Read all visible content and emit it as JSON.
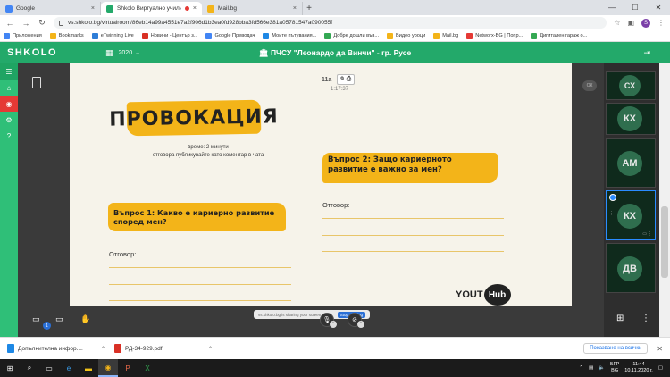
{
  "browser": {
    "tabs": [
      {
        "label": "Google",
        "favicon_color": "#4285f4",
        "close": "×"
      },
      {
        "label": "Shkolo Виртуално училище",
        "favicon_color": "#23a96a",
        "close": "×",
        "recording": true
      },
      {
        "label": "Mail.bg",
        "favicon_color": "#f3b419",
        "close": "×"
      }
    ],
    "new_tab": "+",
    "url": "vs.shkolo.bg/virtualroom/86eb14a99a4551e7a2f906d1b3ea0fd928bba3fd566e381a05781547a090055f",
    "profile_initial": "S"
  },
  "bookmarks": [
    {
      "label": "Приложения",
      "color": "#4285f4"
    },
    {
      "label": "Bookmarks",
      "color": "#f3b419"
    },
    {
      "label": "eTwinning Live",
      "color": "#2e7dd7"
    },
    {
      "label": "Новини - Център з...",
      "color": "#d93025"
    },
    {
      "label": "Google Преводач",
      "color": "#4285f4"
    },
    {
      "label": "Моите пътувания...",
      "color": "#1e88e5"
    },
    {
      "label": "Добре дошли във...",
      "color": "#34a853"
    },
    {
      "label": "Видео уроци",
      "color": "#f3b419"
    },
    {
      "label": "Mail.bg",
      "color": "#f3b419"
    },
    {
      "label": "Networx-BG | Попр...",
      "color": "#e53935"
    },
    {
      "label": "Дигитален гараж о...",
      "color": "#34a853"
    }
  ],
  "app": {
    "logo": "SHKOLO",
    "year": "2020",
    "school": "ПЧСУ \"Леонардо да Винчи\" - гр. Русе",
    "brand_color": "#23a96a"
  },
  "room": {
    "class": "11а",
    "page": "9",
    "timer": "1:17:37"
  },
  "slide": {
    "title": "ПРОВОКАЦИЯ",
    "time_note_line1": "време: 2 минути",
    "time_note_line2": "отговора публикувайте като коментар в чата",
    "q1": "Въпрос 1: Какво е кариерно развитие според мен?",
    "q2": "Въпрос 2: Защо кариерното развитие е важно за мен?",
    "answer_label": "Отговор:",
    "brand_you": "YOUT",
    "brand_hub": "Hub",
    "accent_color": "#f3b419"
  },
  "share_bar": {
    "text": "vs.shkolo.bg is sharing your screen.",
    "stop": "Stop sharing"
  },
  "chat": {
    "count": "1"
  },
  "participants": [
    {
      "initials": "СХ"
    },
    {
      "initials": "КХ"
    },
    {
      "initials": "АМ"
    },
    {
      "initials": "КХ",
      "selected": true
    },
    {
      "initials": "ДВ"
    }
  ],
  "downloads": [
    {
      "name": "Допълнителна инфор....",
      "color": "#1e88e5"
    },
    {
      "name": "РД-34-929.pdf",
      "color": "#d93025"
    }
  ],
  "downloads_show_all": "Показване на всички",
  "taskbar": {
    "lang": "БГР",
    "lang2": "BG",
    "time": "11:44",
    "date": "10.11.2020 г."
  }
}
